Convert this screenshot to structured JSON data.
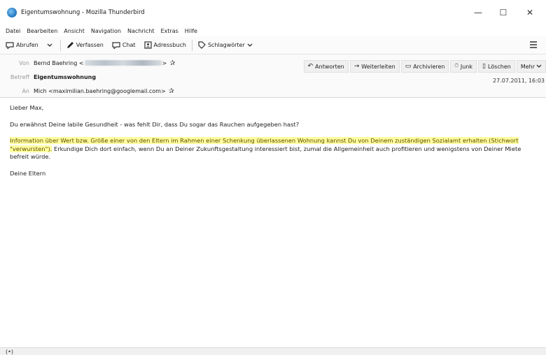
{
  "window": {
    "title": "Eigentumswohnung - Mozilla Thunderbird",
    "minimize": "—",
    "maximize": "☐",
    "close": "✕"
  },
  "menu": [
    "Datei",
    "Bearbeiten",
    "Ansicht",
    "Navigation",
    "Nachricht",
    "Extras",
    "Hilfe"
  ],
  "toolbar": {
    "abrufen": "Abrufen",
    "verfassen": "Verfassen",
    "chat": "Chat",
    "adressbuch": "Adressbuch",
    "schlagwoerter": "Schlagwörter"
  },
  "header": {
    "from_label": "Von",
    "from_name": "Bernd Baehring <",
    "from_suffix": ">",
    "subject_label": "Betreff",
    "subject": "Eigentumswohnung",
    "to_label": "An",
    "to": "Mich <maximilian.baehring@googlemail.com>",
    "date": "27.07.2011, 16:03"
  },
  "actions": {
    "antworten": "Antworten",
    "weiterleiten": "Weiterleiten",
    "archivieren": "Archivieren",
    "junk": "Junk",
    "loeschen": "Löschen",
    "mehr": "Mehr"
  },
  "message": {
    "greeting": "Lieber Max,",
    "line1": "Du erwähnst Deine labile Gesundheit - was fehlt Dir, dass Du sogar das Rauchen aufgegeben hast?",
    "highlight": "Information über Wert bzw. Größe einer von den Eltern im Rahmen einer Schenkung überlassenen Wohnung kannst Du von Deinem zuständigen Sozialamt erhalten (Stichwort \"verwursten\").",
    "rest": " Erkundige Dich dort einfach, wenn Du an Deiner Zukunftsgestaltung interessiert bist, zumal die Allgemeinheit auch profitieren und wenigstens von Deiner Miete befreit würde.",
    "closing": "Deine Eltern"
  },
  "status": {
    "icon": "(•)"
  }
}
